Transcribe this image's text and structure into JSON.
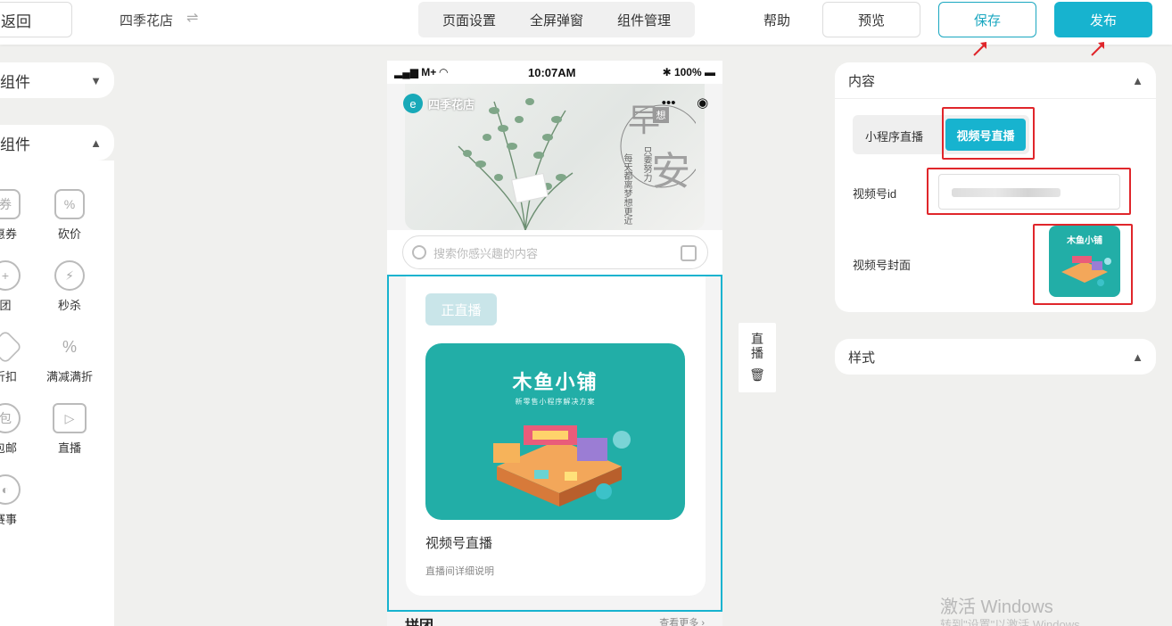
{
  "topbar": {
    "back_label": "返回",
    "shop_name": "四季花店",
    "swap_glyph": "⇌",
    "tabs": [
      "页面设置",
      "全屏弹窗",
      "组件管理"
    ],
    "help": "帮助",
    "preview": "预览",
    "save": "保存",
    "publish": "发布"
  },
  "left": {
    "section1": "组件",
    "section2": "组件",
    "components": [
      "惠券",
      "砍价",
      "团",
      "秒杀",
      "折扣",
      "满减满折",
      "包邮",
      "直播",
      "赛事"
    ]
  },
  "phone": {
    "status_left": "M+",
    "time": "10:07AM",
    "battery": "100%",
    "brand": "四季花店",
    "search_placeholder": "搜索你感兴趣的内容",
    "poem_big1": "早",
    "poem_big2": "安",
    "poem_small": "想",
    "poem_lines": [
      "只要努力",
      "每天都离梦想更近"
    ],
    "live_badge": "正直播",
    "cover_title": "木鱼小铺",
    "cover_sub": "新零售小程序解决方案",
    "live_title": "视频号直播",
    "live_desc": "直播间详细说明",
    "next_title": "拼团",
    "next_more": "查看更多"
  },
  "comp_tag": {
    "l1": "直",
    "l2": "播",
    "delete_icon": "🗑"
  },
  "right": {
    "content_title": "内容",
    "tab_miniapp": "小程序直播",
    "tab_channels": "视频号直播",
    "id_label": "视频号id",
    "cover_label": "视频号封面",
    "thumb_title": "木鱼小铺",
    "style_title": "样式"
  },
  "watermark": {
    "l1": "激活 Windows",
    "l2": "转到\"设置\"以激活 Windows"
  },
  "colors": {
    "accent": "#17b3cf",
    "highlight": "#e0262b"
  }
}
